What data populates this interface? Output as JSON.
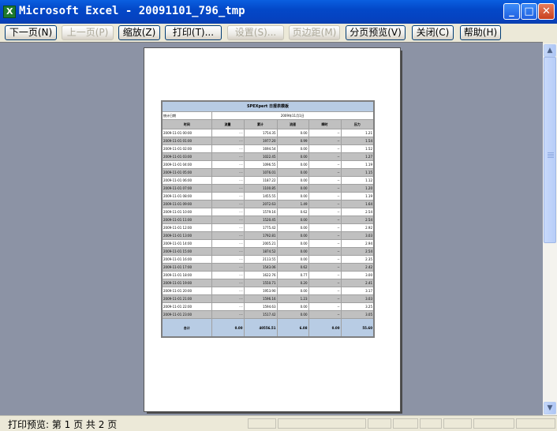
{
  "window": {
    "title": "Microsoft Excel - 20091101_796_tmp",
    "min": "_",
    "max": "□",
    "close": "✕"
  },
  "toolbar": {
    "next": "下一页(N)",
    "prev": "上一页(P)",
    "zoom": "缩放(Z)",
    "print": "打印(T)...",
    "setup": "设置(S)...",
    "margins": "页边距(M)",
    "break_preview": "分页预览(V)",
    "close": "关闭(C)",
    "help": "帮助(H)"
  },
  "status": {
    "text": "打印预览: 第 1 页  共 2 页"
  },
  "sheet": {
    "title": "SPEXpert 日报表模板",
    "meta_label": "统计日期",
    "meta_value": "2009年11月1日",
    "headers": [
      "时间",
      "流量",
      "累计",
      "流速",
      "瞬时",
      "压力"
    ],
    "rows": [
      [
        "2009-11-01 00:00",
        "- -",
        "1754.35",
        "0.00",
        "--",
        "1.21"
      ],
      [
        "2009-11-01 01:00",
        "- -",
        "1977.20",
        "0.99",
        "--",
        "1.54"
      ],
      [
        "2009-11-01 02:00",
        "- -",
        "1694.54",
        "0.00",
        "--",
        "1.52"
      ],
      [
        "2009-11-01 03:00",
        "- -",
        "1022.45",
        "0.00",
        "--",
        "1.27"
      ],
      [
        "2009-11-01 04:00",
        "- -",
        "1096.55",
        "0.00",
        "--",
        "1.19"
      ],
      [
        "2009-11-01 05:00",
        "- -",
        "1076.01",
        "0.00",
        "--",
        "1.15"
      ],
      [
        "2009-11-01 06:00",
        "- -",
        "1187.22",
        "0.00",
        "--",
        "1.12"
      ],
      [
        "2009-11-01 07:00",
        "- -",
        "1100.85",
        "0.00",
        "--",
        "1.20"
      ],
      [
        "2009-11-01 08:00",
        "- -",
        "1455.55",
        "0.00",
        "--",
        "1.19"
      ],
      [
        "2009-11-01 09:00",
        "- -",
        "2072.63",
        "1.49",
        "--",
        "1.64"
      ],
      [
        "2009-11-01 10:00",
        "- -",
        "1579.16",
        "0.62",
        "--",
        "2.54"
      ],
      [
        "2009-11-01 11:00",
        "- -",
        "1520.45",
        "0.00",
        "--",
        "2.54"
      ],
      [
        "2009-11-01 12:00",
        "- -",
        "1775.42",
        "0.00",
        "--",
        "2.92"
      ],
      [
        "2009-11-01 13:00",
        "- -",
        "1792.81",
        "0.00",
        "--",
        "3.03"
      ],
      [
        "2009-11-01 14:00",
        "- -",
        "2005.21",
        "0.00",
        "--",
        "2.94"
      ],
      [
        "2009-11-01 15:00",
        "- -",
        "1874.52",
        "0.00",
        "--",
        "2.54"
      ],
      [
        "2009-11-01 16:00",
        "- -",
        "2113.55",
        "0.00",
        "--",
        "2.35"
      ],
      [
        "2009-11-01 17:00",
        "- -",
        "1543.06",
        "0.62",
        "--",
        "2.42"
      ],
      [
        "2009-11-01 18:00",
        "- -",
        "1622.76",
        "0.77",
        "--",
        "3.00"
      ],
      [
        "2009-11-01 19:00",
        "- -",
        "1550.71",
        "0.20",
        "--",
        "2.41"
      ],
      [
        "2009-11-01 20:00",
        "- -",
        "1953.90",
        "0.00",
        "--",
        "3.17"
      ],
      [
        "2009-11-01 21:00",
        "- -",
        "1596.16",
        "1.23",
        "--",
        "3.03"
      ],
      [
        "2009-11-01 22:00",
        "- -",
        "1594.63",
        "0.00",
        "--",
        "3.25"
      ],
      [
        "2009-11-01 23:00",
        "- -",
        "1517.42",
        "0.00",
        "--",
        "3.05"
      ]
    ],
    "total": [
      "合计",
      "0.00",
      "40556.51",
      "6.08",
      "0.00",
      "55.60"
    ]
  }
}
